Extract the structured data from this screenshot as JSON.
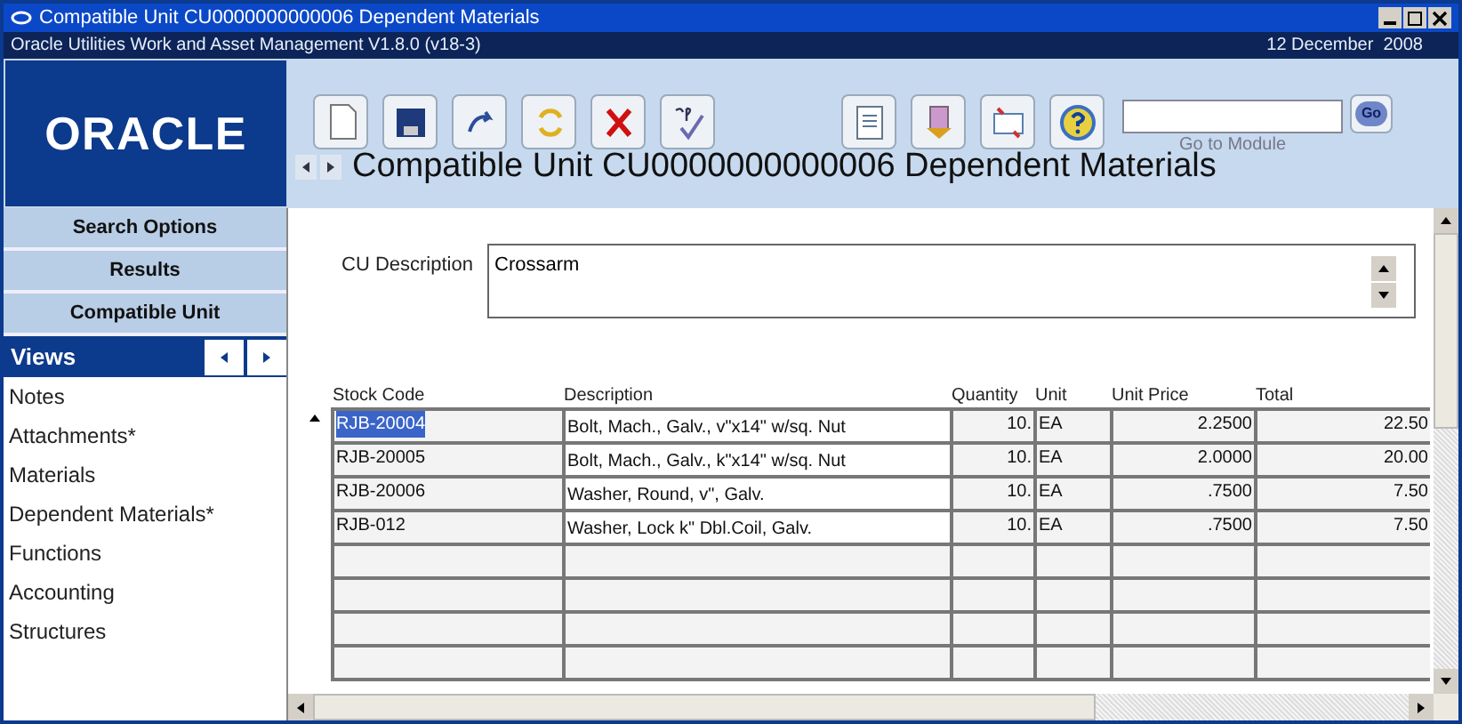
{
  "window": {
    "title": "Compatible Unit CU0000000000006 Dependent Materials",
    "app": "Oracle Utilities Work and Asset Management V1.8.0 (v18-3)",
    "date": "12 December  2008"
  },
  "logo": "ORACLE",
  "goto": {
    "caption": "Go to Module",
    "button": "Go"
  },
  "page_title": "Compatible Unit CU0000000000006 Dependent Materials",
  "sidebar": {
    "sections": [
      "Search Options",
      "Results",
      "Compatible Unit"
    ],
    "views_label": "Views",
    "items": [
      "Notes",
      "Attachments*",
      "Materials",
      "Dependent Materials*",
      "Functions",
      "Accounting",
      "Structures"
    ]
  },
  "cu_description": {
    "label": "CU Description",
    "value": "Crossarm"
  },
  "table": {
    "columns": [
      "Stock Code",
      "Description",
      "Quantity",
      "Unit",
      "Unit Price",
      "Total"
    ],
    "rows": [
      {
        "cells": [
          "RJB-20004",
          "Bolt, Mach., Galv., v\"x14\" w/sq. Nut",
          "10.",
          "EA",
          "2.2500",
          "22.50"
        ],
        "selected": true
      },
      {
        "cells": [
          "RJB-20005",
          "Bolt, Mach., Galv., k\"x14\" w/sq. Nut",
          "10.",
          "EA",
          "2.0000",
          "20.00"
        ],
        "selected": false
      },
      {
        "cells": [
          "RJB-20006",
          "Washer, Round, v\", Galv.",
          "10.",
          "EA",
          ".7500",
          "7.50"
        ],
        "selected": false
      },
      {
        "cells": [
          "RJB-012",
          "Washer, Lock k\" Dbl.Coil, Galv.",
          "10.",
          "EA",
          ".7500",
          "7.50"
        ],
        "selected": false
      }
    ]
  }
}
